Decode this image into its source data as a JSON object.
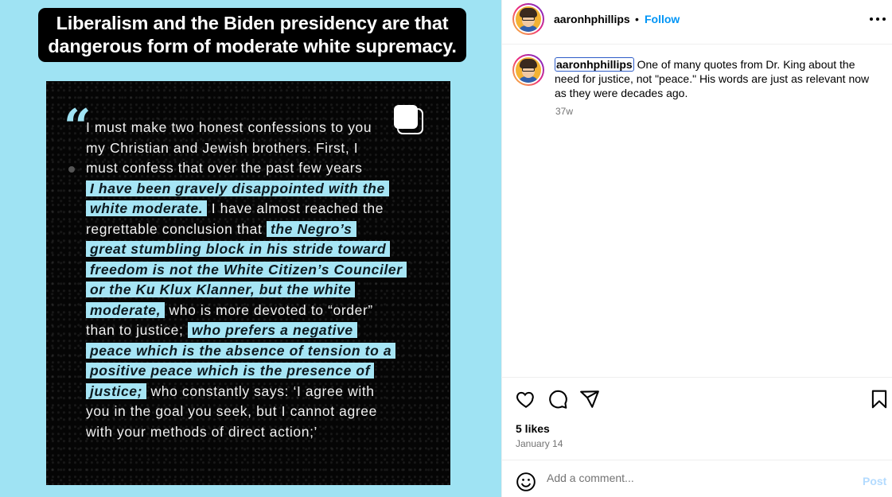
{
  "post": {
    "headline": [
      "Liberalism and the Biden presidency are that",
      "dangerous form of moderate white supremacy."
    ],
    "quote_lines": [
      [
        {
          "t": "I must make two honest confessions to you",
          "h": false
        }
      ],
      [
        {
          "t": "my Christian and Jewish brothers. First, I",
          "h": false
        }
      ],
      [
        {
          "t": "must confess that over the past few years",
          "h": false
        }
      ],
      [
        {
          "t": "I have been gravely disappointed with the",
          "h": true
        }
      ],
      [
        {
          "t": "white moderate.",
          "h": true
        },
        {
          "t": " I have almost reached the",
          "h": false
        }
      ],
      [
        {
          "t": "regrettable conclusion that ",
          "h": false
        },
        {
          "t": "the Negro’s",
          "h": true
        }
      ],
      [
        {
          "t": "great stumbling block in his stride toward",
          "h": true
        }
      ],
      [
        {
          "t": "freedom is not the White Citizen’s Counciler",
          "h": true
        }
      ],
      [
        {
          "t": "or the Ku Klux Klanner, but the white",
          "h": true
        }
      ],
      [
        {
          "t": "moderate,",
          "h": true
        },
        {
          "t": " who is more devoted to “order”",
          "h": false
        }
      ],
      [
        {
          "t": "than to justice; ",
          "h": false
        },
        {
          "t": "who prefers a negative",
          "h": true
        }
      ],
      [
        {
          "t": "peace which is the absence of tension to a",
          "h": true
        }
      ],
      [
        {
          "t": "positive peace which is the presence of",
          "h": true
        }
      ],
      [
        {
          "t": "justice;",
          "h": true
        },
        {
          "t": " who constantly says: ‘I agree with",
          "h": false
        }
      ],
      [
        {
          "t": "you in the goal you seek, but I cannot agree",
          "h": false
        }
      ],
      [
        {
          "t": "with your methods of direct action;’",
          "h": false
        }
      ]
    ],
    "quote_symbol": "“"
  },
  "header": {
    "username": "aaronhphillips",
    "separator": "•",
    "follow_label": "Follow",
    "more_icon": "more-options-icon"
  },
  "caption": {
    "username": "aaronhphillips",
    "text": " One of many quotes from Dr. King about the need for justice, not \"peace.\" His words are just as relevant now as they were decades ago.",
    "time_ago": "37w"
  },
  "actions": {
    "icons": [
      "heart-icon",
      "comment-icon",
      "share-icon",
      "bookmark-icon"
    ],
    "likes": "5 likes",
    "date": "January 14"
  },
  "comment": {
    "placeholder": "Add a comment...",
    "post_label": "Post",
    "emoji_icon": "emoji-icon"
  },
  "colors": {
    "accent": "#0095f6",
    "media_bg": "#9fe3f3",
    "highlight": "#a6e5f5"
  }
}
